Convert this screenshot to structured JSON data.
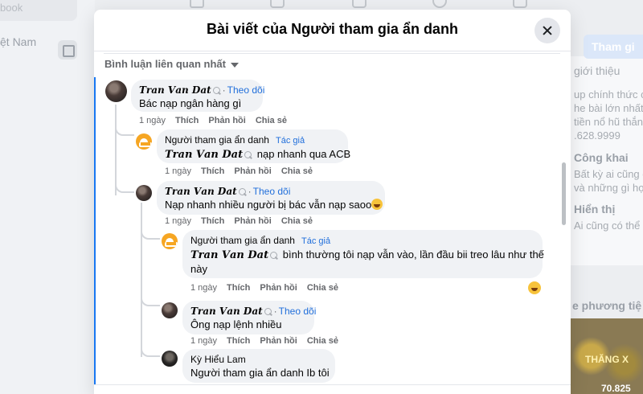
{
  "background": {
    "left_top_text": "book",
    "left_text": "ệt Nam",
    "join_button": "Tham gi",
    "right_texts": [
      "giới thiệu",
      "up chính thức c",
      "he bài lớn nhất V",
      "tiền nổ hũ thắn",
      ".628.9999"
    ],
    "public_title": "Công khai",
    "public_text": [
      "Bất kỳ ai cũng c",
      "và những gì họ"
    ],
    "visible_title": "Hiển thị",
    "visible_text": "Ai cũng có thể",
    "media_title": "e phương tiệ",
    "media_overlay": "THĂNG X",
    "media_number": "70.825"
  },
  "modal": {
    "title": "Bài viết của Người tham gia ẩn danh",
    "sort_label": "Bình luận liên quan nhất"
  },
  "comments": [
    {
      "author": "𝑻𝒓𝒂𝒏 𝑽𝒂𝒏 𝑫𝒂𝒕",
      "follow": "Theo dõi",
      "text": "Bác nạp ngân hàng gì",
      "time": "1 ngày",
      "like": "Thích",
      "reply": "Phản hồi",
      "share": "Chia sẻ"
    },
    {
      "author": "Người tham gia ẩn danh",
      "badge": "Tác giả",
      "mention": "𝑻𝒓𝒂𝒏 𝑽𝒂𝒏 𝑫𝒂𝒕",
      "text": "nạp nhanh qua ACB",
      "time": "1 ngày",
      "like": "Thích",
      "reply": "Phản hồi",
      "share": "Chia sẻ"
    },
    {
      "author": "𝑻𝒓𝒂𝒏 𝑽𝒂𝒏 𝑫𝒂𝒕",
      "follow": "Theo dõi",
      "text": "Nạp nhanh nhiều người bị bác vẫn nạp saoo",
      "time": "1 ngày",
      "like": "Thích",
      "reply": "Phản hồi",
      "share": "Chia sẻ"
    },
    {
      "author": "Người tham gia ẩn danh",
      "badge": "Tác giả",
      "mention": "𝑻𝒓𝒂𝒏 𝑽𝒂𝒏 𝑫𝒂𝒕",
      "text_line1": "bình thường tôi nạp vẫn vào, lần đầu bii treo lâu như thế",
      "text_line2": "này",
      "time": "1 ngày",
      "like": "Thích",
      "reply": "Phản hồi",
      "share": "Chia sẻ"
    },
    {
      "author": "𝑻𝒓𝒂𝒏 𝑽𝒂𝒏 𝑫𝒂𝒕",
      "follow": "Theo dõi",
      "text": "Ông nạp lệnh nhiều",
      "time": "1 ngày",
      "like": "Thích",
      "reply": "Phản hồi",
      "share": "Chia sẻ"
    },
    {
      "author": "Kỳ Hiểu Lam",
      "text": "Người tham gia ẩn danh Ib tôi"
    }
  ],
  "colors": {
    "accent": "#1877f2",
    "link": "#216fdb",
    "bubble": "#f0f2f5",
    "secondary_text": "#65676b"
  }
}
